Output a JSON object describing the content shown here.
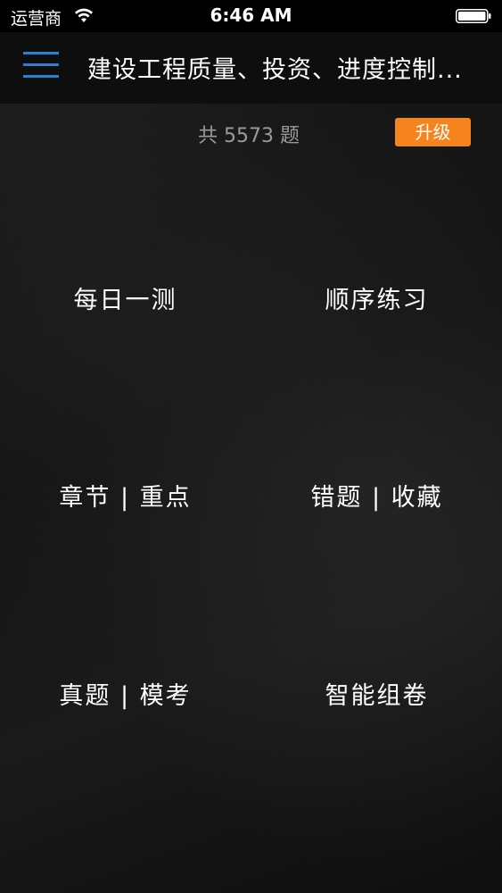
{
  "status_bar": {
    "carrier": "运营商",
    "time": "6:46 AM",
    "wifi_icon": "wifi-icon",
    "battery_icon": "battery-icon",
    "battery_level": 1.0
  },
  "nav": {
    "menu_icon": "hamburger-menu-icon",
    "accent_color": "#2b7fd6",
    "title": "建设工程质量、投资、进度控制..."
  },
  "info": {
    "count_text": "共 5573 题",
    "upgrade_label": "升级",
    "upgrade_color": "#f5841f"
  },
  "menu": {
    "items": [
      {
        "label": "每日一测"
      },
      {
        "label": "顺序练习"
      },
      {
        "label": "章节 | 重点"
      },
      {
        "label": "错题 | 收藏"
      },
      {
        "label": "真题 | 模考"
      },
      {
        "label": "智能组卷"
      }
    ]
  }
}
